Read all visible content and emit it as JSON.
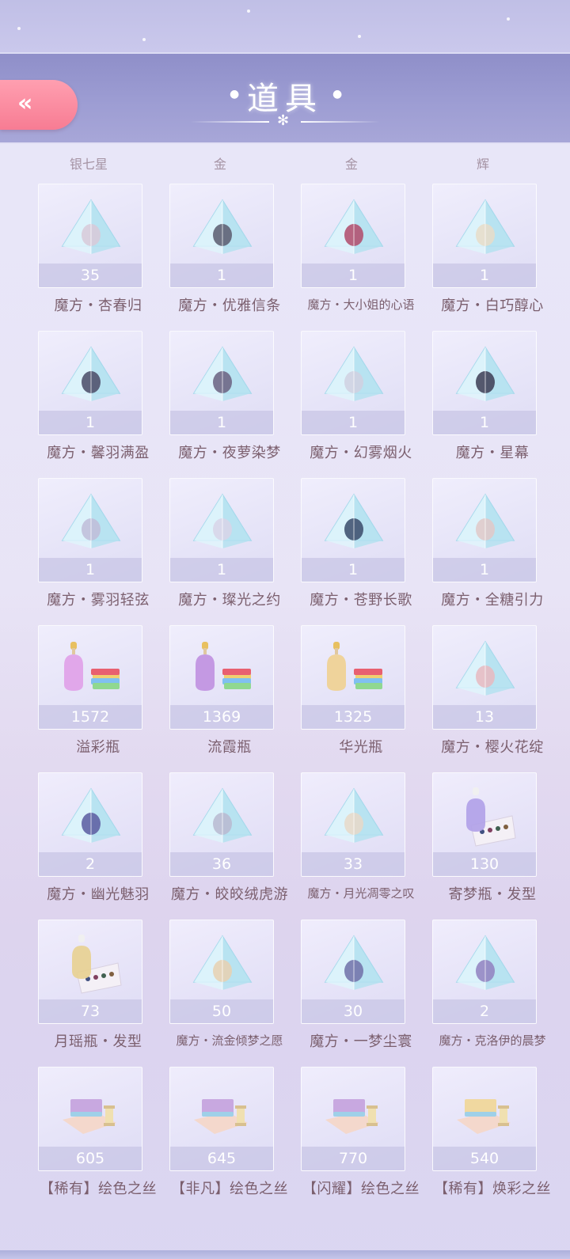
{
  "header": {
    "title": "道具",
    "back_icon": "«"
  },
  "cut_row": [
    "银七星",
    "金",
    "金",
    "辉"
  ],
  "items": [
    {
      "name": "魔方・杏春归",
      "count": "35",
      "icon": "cube",
      "tint": "#d8c9d8"
    },
    {
      "name": "魔方・优雅信条",
      "count": "1",
      "icon": "cube",
      "tint": "#5a5a6e"
    },
    {
      "name": "魔方・大小姐的心语",
      "count": "1",
      "icon": "cube",
      "tint": "#b04a6a"
    },
    {
      "name": "魔方・白巧醇心",
      "count": "1",
      "icon": "cube",
      "tint": "#e8dcc8"
    },
    {
      "name": "魔方・馨羽满盈",
      "count": "1",
      "icon": "cube",
      "tint": "#4a4a66"
    },
    {
      "name": "魔方・夜萝染梦",
      "count": "1",
      "icon": "cube",
      "tint": "#6a6080"
    },
    {
      "name": "魔方・幻雾烟火",
      "count": "1",
      "icon": "cube",
      "tint": "#d0d0e0"
    },
    {
      "name": "魔方・星幕",
      "count": "1",
      "icon": "cube",
      "tint": "#3c3c54"
    },
    {
      "name": "魔方・雾羽轻弦",
      "count": "1",
      "icon": "cube",
      "tint": "#c0bcd8"
    },
    {
      "name": "魔方・璨光之约",
      "count": "1",
      "icon": "cube",
      "tint": "#d8d4e8"
    },
    {
      "name": "魔方・苍野长歌",
      "count": "1",
      "icon": "cube",
      "tint": "#3a4a6a"
    },
    {
      "name": "魔方・全糖引力",
      "count": "1",
      "icon": "cube",
      "tint": "#e0c8c8"
    },
    {
      "name": "溢彩瓶",
      "count": "1572",
      "icon": "bottle",
      "tint": "#e0a0e8"
    },
    {
      "name": "流霞瓶",
      "count": "1369",
      "icon": "bottle",
      "tint": "#c090e0"
    },
    {
      "name": "华光瓶",
      "count": "1325",
      "icon": "bottle",
      "tint": "#f0d090"
    },
    {
      "name": "魔方・樱火花绽",
      "count": "13",
      "icon": "cube",
      "tint": "#e8b8c0"
    },
    {
      "name": "魔方・幽光魅羽",
      "count": "2",
      "icon": "cube",
      "tint": "#5a5aa0"
    },
    {
      "name": "魔方・皎皎绒虎游",
      "count": "36",
      "icon": "cube",
      "tint": "#b8b8d0"
    },
    {
      "name": "魔方・月光凋零之叹",
      "count": "33",
      "icon": "cube",
      "tint": "#e8d8c8"
    },
    {
      "name": "寄梦瓶・发型",
      "count": "130",
      "icon": "hairbottle",
      "tint": "#b0a0e8"
    },
    {
      "name": "月瑶瓶・发型",
      "count": "73",
      "icon": "hairbottle",
      "tint": "#e8d090"
    },
    {
      "name": "魔方・流金倾梦之愿",
      "count": "50",
      "icon": "cube",
      "tint": "#e8d0b0"
    },
    {
      "name": "魔方・一梦尘寰",
      "count": "30",
      "icon": "cube",
      "tint": "#7070a8"
    },
    {
      "name": "魔方・克洛伊的晨梦",
      "count": "2",
      "icon": "cube",
      "tint": "#9080c0"
    },
    {
      "name": "【稀有】绘色之丝",
      "count": "605",
      "icon": "fabric",
      "tint": "#c8a8e0"
    },
    {
      "name": "【非凡】绘色之丝",
      "count": "645",
      "icon": "fabric",
      "tint": "#c8a8e0"
    },
    {
      "name": "【闪耀】绘色之丝",
      "count": "770",
      "icon": "fabric",
      "tint": "#c8a8e0"
    },
    {
      "name": "【稀有】焕彩之丝",
      "count": "540",
      "icon": "fabric",
      "tint": "#f0d8a0"
    }
  ]
}
